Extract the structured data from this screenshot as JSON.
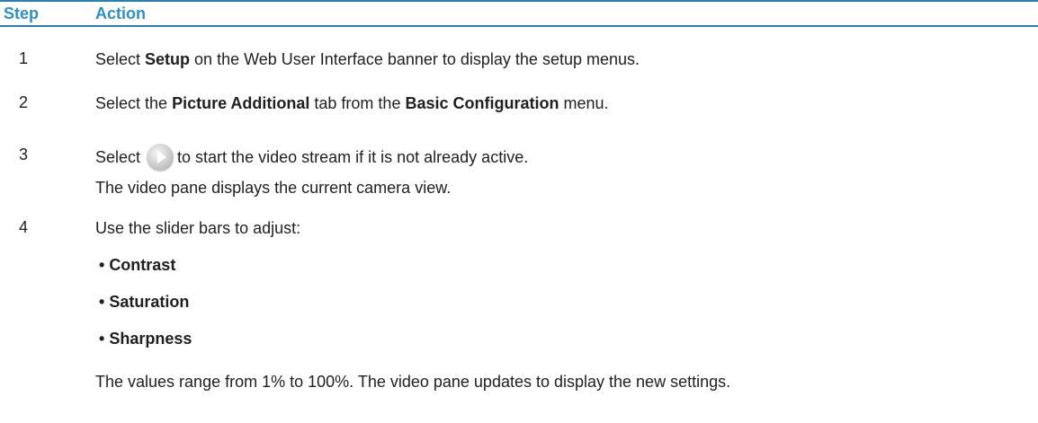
{
  "table": {
    "header": {
      "step": "Step",
      "action": "Action"
    },
    "rows": [
      {
        "step": "1",
        "text_before": "Select ",
        "bold": "Setup",
        "text_after": " on the Web User Interface banner to display the setup menus."
      },
      {
        "step": "2",
        "text_a": "Select the ",
        "bold_a": "Picture Additional",
        "text_b": " tab from the ",
        "bold_b": "Basic Configuration",
        "text_c": " menu."
      },
      {
        "step": "3",
        "text_before": "Select",
        "icon": "play-button-icon",
        "text_after": "to start the video stream if it is not already active.",
        "note": "The video pane displays the current camera view."
      },
      {
        "step": "4",
        "text": "Use the slider bars to adjust:",
        "bullets": [
          "Contrast",
          "Saturation",
          "Sharpness"
        ],
        "note": "The values range from 1% to 100%. The video pane updates to display the new settings."
      }
    ]
  },
  "colors": {
    "header_text": "#2f8ec8",
    "rule": "#2c7fb3",
    "body_text": "#1f1f1f"
  }
}
